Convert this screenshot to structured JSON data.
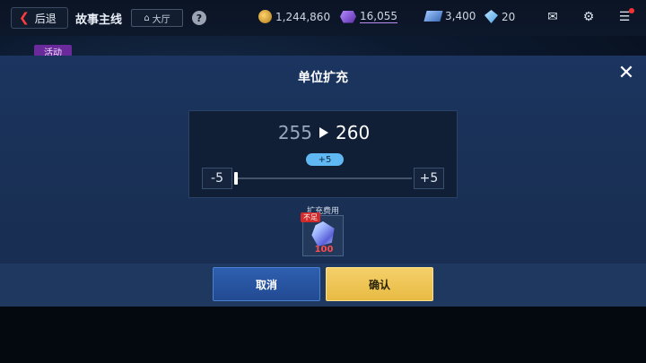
{
  "topbar": {
    "back_label": "后退",
    "title": "故事主线",
    "hall_label": "大厅",
    "help_symbol": "?",
    "resources": [
      {
        "icon": "coin-icon",
        "value": "1,244,860"
      },
      {
        "icon": "purple-crystal-icon",
        "value": "16,055"
      },
      {
        "icon": "ticket-icon",
        "value": "3,400"
      },
      {
        "icon": "gem-icon",
        "value": "20"
      }
    ]
  },
  "activity_tag": "活动",
  "modal": {
    "title": "单位扩充",
    "close_symbol": "✕",
    "current_count": "255",
    "new_count": "260",
    "delta": "+5",
    "minus_label": "-5",
    "plus_label": "+5",
    "slider_position": 0,
    "cost_label": "扩充费用",
    "cost_badge": "不足",
    "cost_amount": "100",
    "cancel_label": "取消",
    "confirm_label": "确认"
  },
  "colors": {
    "confirm": "#e8bb43",
    "cancel": "#2a5aa8",
    "insufficient": "#d22a2a",
    "delta_pill": "#5fb8f2"
  }
}
